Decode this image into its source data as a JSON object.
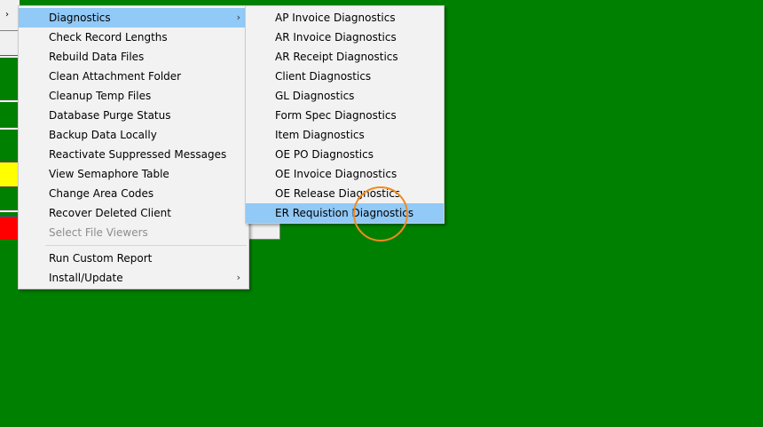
{
  "background_color": "#008000",
  "highlight_color": "#91c9f7",
  "cursor_ring_color": "#f28a1e",
  "left_strip": {
    "submenu_arrow": "›"
  },
  "main_menu": {
    "items": [
      {
        "label": "Diagnostics",
        "has_submenu": true,
        "highlighted": true
      },
      {
        "label": "Check Record Lengths"
      },
      {
        "label": "Rebuild Data Files"
      },
      {
        "label": "Clean Attachment Folder"
      },
      {
        "label": "Cleanup Temp Files"
      },
      {
        "label": "Database Purge Status"
      },
      {
        "label": "Backup Data Locally"
      },
      {
        "label": "Reactivate Suppressed Messages"
      },
      {
        "label": "View Semaphore Table"
      },
      {
        "label": "Change Area Codes"
      },
      {
        "label": "Recover Deleted Client"
      },
      {
        "label": "Select File Viewers",
        "disabled": true
      }
    ],
    "items_after_separator": [
      {
        "label": "Run Custom Report"
      },
      {
        "label": "Install/Update",
        "has_submenu": true
      }
    ],
    "submenu_arrow": "›"
  },
  "sub_menu": {
    "items": [
      {
        "label": "AP Invoice Diagnostics"
      },
      {
        "label": "AR Invoice Diagnostics"
      },
      {
        "label": "AR Receipt Diagnostics"
      },
      {
        "label": "Client Diagnostics"
      },
      {
        "label": "GL Diagnostics"
      },
      {
        "label": "Form Spec Diagnostics"
      },
      {
        "label": "Item Diagnostics"
      },
      {
        "label": "OE PO Diagnostics"
      },
      {
        "label": "OE Invoice Diagnostics"
      },
      {
        "label": "OE Release Diagnostics"
      },
      {
        "label": "ER Requistion Diagnostics",
        "highlighted": true
      }
    ]
  }
}
